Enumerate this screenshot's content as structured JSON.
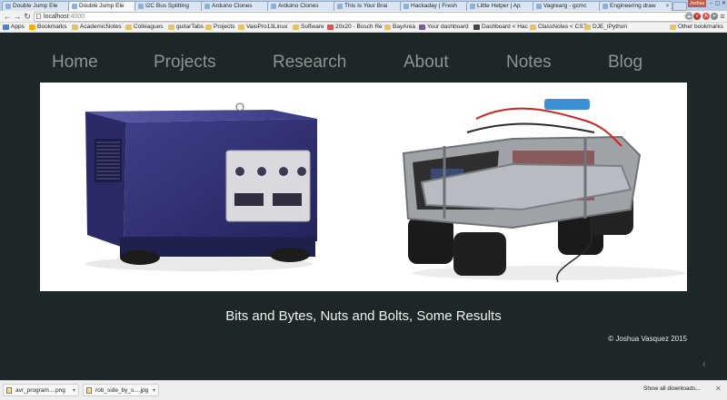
{
  "tabs": [
    {
      "label": "Double Jump Ele",
      "active": false
    },
    {
      "label": "Double Jump Ele",
      "active": true
    },
    {
      "label": "I2C Bus Splitting",
      "active": false
    },
    {
      "label": "Arduino Clones",
      "active": false
    },
    {
      "label": "Arduino Clones",
      "active": false
    },
    {
      "label": "This Is Your Brai",
      "active": false
    },
    {
      "label": "Hackaday | Fresh",
      "active": false
    },
    {
      "label": "Little Helper | Ap",
      "active": false
    },
    {
      "label": "Vagrearg - gcmc",
      "active": false
    },
    {
      "label": "Engineering draw",
      "active": false
    }
  ],
  "window": {
    "user_label": "Joshua",
    "minimize": "–",
    "maximize": "▢",
    "close": "✕"
  },
  "address_bar": {
    "url_host": "localhost",
    "url_port": ":4000",
    "back": "←",
    "forward": "→",
    "reload": "↻",
    "star": "☆",
    "menu": "≡"
  },
  "extensions": [
    {
      "name": "cloud-icon",
      "glyph": "☁",
      "color": "#9aa3ad"
    },
    {
      "name": "vimium-icon",
      "glyph": "V",
      "color": "#c0392b"
    },
    {
      "name": "adblock-icon",
      "glyph": "A",
      "color": "#d9534f"
    },
    {
      "name": "puzzle-icon",
      "glyph": "✦",
      "color": "#7f8c8d"
    }
  ],
  "bookmarks": [
    {
      "label": "Apps",
      "color": "#4a7ed6"
    },
    {
      "label": "Bookmarks",
      "color": "#f0b400"
    },
    {
      "label": "AcademicNotes",
      "color": "#e6c26a"
    },
    {
      "label": "Colleagues",
      "color": "#e6c26a"
    },
    {
      "label": "guitarTabs",
      "color": "#e6c26a"
    },
    {
      "label": "Projects",
      "color": "#e6c26a"
    },
    {
      "label": "VaioPro13Linux",
      "color": "#e6c26a"
    },
    {
      "label": "Software",
      "color": "#e6c26a"
    },
    {
      "label": "20x20 - Bosch Re",
      "color": "#d9534f"
    },
    {
      "label": "BayArea",
      "color": "#e6c26a"
    },
    {
      "label": "Your dashboard",
      "color": "#7a5aa8"
    },
    {
      "label": "Dashboard < Hac",
      "color": "#444444"
    },
    {
      "label": "ClassNotes < CS7",
      "color": "#e6c26a"
    },
    {
      "label": "DJE_IPython",
      "color": "#e6c26a"
    },
    {
      "label": "Other bookmarks",
      "color": "#e6c26a"
    }
  ],
  "site_nav": [
    {
      "label": "Home"
    },
    {
      "label": "Projects"
    },
    {
      "label": "Research"
    },
    {
      "label": "About"
    },
    {
      "label": "Notes"
    },
    {
      "label": "Blog"
    }
  ],
  "hero": {
    "alt": "GameCube console robot and small aluminium-frame rover robot"
  },
  "tagline": "Bits and Bytes, Nuts and Bolts, Some Results",
  "footer": {
    "copyright": "© Joshua Vasquez 2015",
    "back_arrow": "‹"
  },
  "downloads": [
    {
      "filename": "avr_program....png"
    },
    {
      "filename": "rob_side_by_s....jpg"
    }
  ],
  "downloads_shelf": {
    "show_all": "Show all downloads...",
    "close": "✕"
  }
}
